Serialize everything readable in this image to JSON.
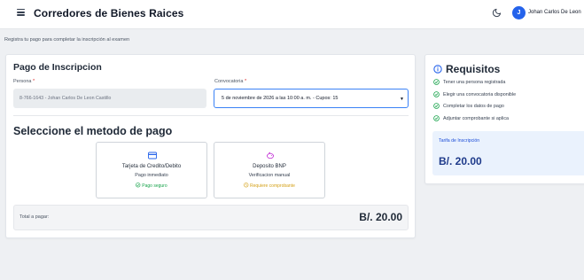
{
  "header": {
    "title": "Corredores de Bienes Raices",
    "user_initial": "J",
    "user_name": "Johan Carlos De Leon"
  },
  "subtitle": "Registra tu pago para completar la inscripción al examen",
  "payment": {
    "title": "Pago de Inscripcion",
    "persona_label": "Persona",
    "persona_value": "8-766-1643 - Johan Carlos De Leon Castillo",
    "convocatoria_label": "Convocatoria",
    "convocatoria_value": "5 de noviembre de 2026 a las 10:00 a. m. - Cupos: 15",
    "required_mark": "*"
  },
  "method": {
    "title": "Seleccione el metodo de pago",
    "options": [
      {
        "name": "Tarjeta de Credito/Debito",
        "desc": "Pago inmediato",
        "tag": "Pago seguro",
        "icon": "credit-card-icon",
        "tag_color": "#16a34a"
      },
      {
        "name": "Deposito BNP",
        "desc": "Verificacion manual",
        "tag": "Requiere comprobante",
        "icon": "piggy-bank-icon",
        "tag_color": "#d4a017"
      }
    ]
  },
  "total": {
    "label": "Total a pagar:",
    "amount": "B/. 20.00"
  },
  "requirements": {
    "title": "Requisitos",
    "items": [
      "Tener una persona registrada",
      "Elegir una convocatoria disponible",
      "Completar los datos de pago",
      "Adjuntar comprobante si aplica"
    ],
    "tarifa_label": "Tarifa de Inscripción",
    "tarifa_amount": "B/. 20.00"
  },
  "colors": {
    "accent": "#2563eb",
    "check_green": "#16a34a",
    "required_red": "#dc2626"
  }
}
